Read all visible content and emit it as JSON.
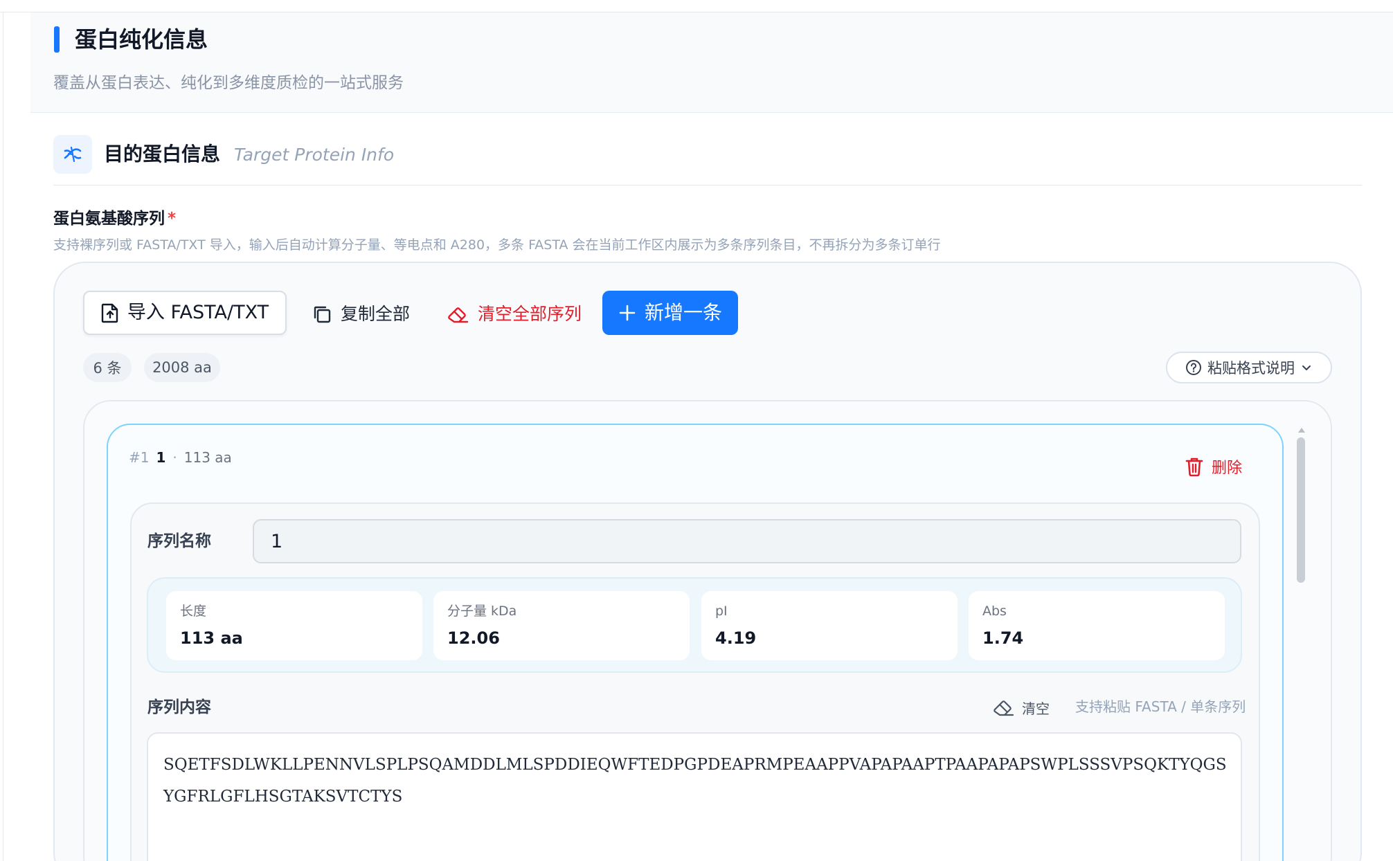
{
  "section": {
    "title": "蛋白纯化信息",
    "subtitle": "覆盖从蛋白表达、纯化到多维度质检的一站式服务"
  },
  "target_info": {
    "title": "目的蛋白信息",
    "title_en": "Target Protein Info",
    "icon": "dna-icon"
  },
  "field": {
    "label": "蛋白氨基酸序列",
    "required_mark": "*",
    "help": "支持裸序列或 FASTA/TXT 导入，输入后自动计算分子量、等电点和 A280，多条 FASTA 会在当前工作区内展示为多条序列条目，不再拆分为多条订单行"
  },
  "toolbar": {
    "import_label": "导入 FASTA/TXT",
    "copy_all_label": "复制全部",
    "clear_all_label": "清空全部序列",
    "add_label": "新增一条",
    "paste_help_label": "粘贴格式说明"
  },
  "summary": {
    "count": "6 条",
    "total_aa": "2008 aa"
  },
  "sequence_entry": {
    "index": "#1",
    "name": "1",
    "separator": "·",
    "length": "113 aa",
    "delete_label": "删除",
    "name_field_label": "序列名称",
    "name_value": "1",
    "stats": [
      {
        "label": "长度",
        "value": "113 aa"
      },
      {
        "label": "分子量 kDa",
        "value": "12.06"
      },
      {
        "label": "pI",
        "value": "4.19"
      },
      {
        "label": "Abs",
        "value": "1.74"
      }
    ],
    "content_label": "序列内容",
    "clear_label": "清空",
    "content_hint": "支持粘贴 FASTA / 单条序列",
    "sequence": "SQETFSDLWKLLPENNVLSPLPSQAMDDLMLSPDDIEQWFTEDPGPDEAPRMPEAAPPVAPAPAAPTPAAPAPAPSWPLSSSVPSQKTYQGSYGFRLGFLHSGTAKSVTCTYS"
  },
  "colors": {
    "primary": "#1677ff",
    "danger": "#e11d2a",
    "card_border": "#7dd3fc"
  }
}
